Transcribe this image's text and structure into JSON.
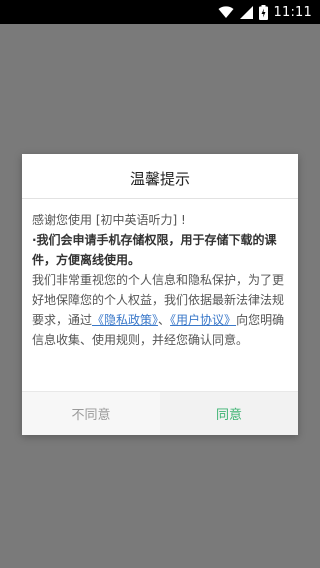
{
  "status_bar": {
    "time": "11:11",
    "icons": [
      "wifi-icon",
      "signal-icon",
      "battery-icon"
    ]
  },
  "dialog": {
    "title": "温馨提示",
    "intro": "感谢您使用 [初中英语听力] !",
    "permission_text": "·我们会申请手机存储权限，用于存储下载的课件，方便离线使用。",
    "privacy_text_1": "我们非常重视您的个人信息和隐私保护，为了更好地保障您的个人权益，我们依据最新法律法规要求，通过",
    "privacy_policy_link": "《隐私政策》",
    "separator": "、",
    "user_agreement_link": "《用户协议》",
    "privacy_text_2": "向您明确信息收集、使用规则，并经您确认同意。",
    "disagree_label": "不同意",
    "agree_label": "同意"
  },
  "colors": {
    "overlay": "#7a7a7a",
    "link": "#3a78c9",
    "agree": "#3cb371",
    "disagree": "#9a9a9a"
  }
}
